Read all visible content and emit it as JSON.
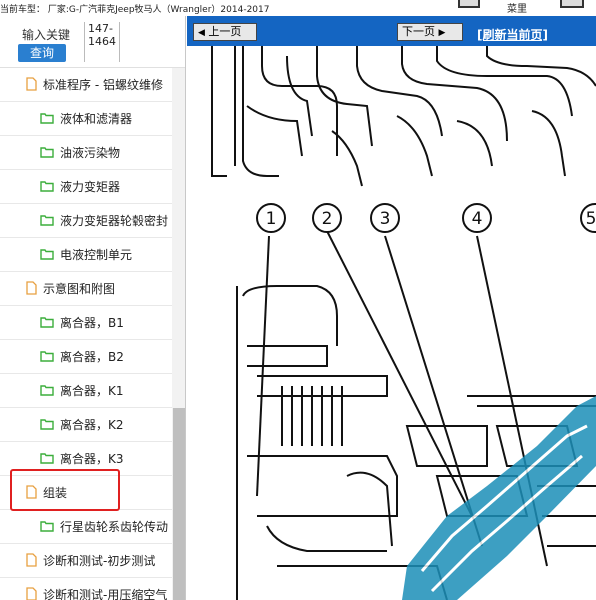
{
  "topbar": {
    "car_info": "当前车型： 厂家:G-广汽菲克Jeep牧马人（Wrangler）2014-2017",
    "menu_label": "菜里"
  },
  "search": {
    "label": "输入关键",
    "value": "147-\n1464",
    "button": "查询"
  },
  "tree": [
    {
      "label": "标准程序 - 铝螺纹维修",
      "icon": "file-icon",
      "level": 1
    },
    {
      "label": "液体和滤清器",
      "icon": "folder-icon",
      "level": 2
    },
    {
      "label": "油液污染物",
      "icon": "folder-icon",
      "level": 2
    },
    {
      "label": "液力变矩器",
      "icon": "folder-icon",
      "level": 2
    },
    {
      "label": "液力变矩器轮毂密封",
      "icon": "folder-icon",
      "level": 2
    },
    {
      "label": "电液控制单元",
      "icon": "folder-icon",
      "level": 2
    },
    {
      "label": "示意图和附图",
      "icon": "file-icon",
      "level": 1
    },
    {
      "label": "离合器，B1",
      "icon": "folder-icon",
      "level": 2
    },
    {
      "label": "离合器，B2",
      "icon": "folder-icon",
      "level": 2
    },
    {
      "label": "离合器，K1",
      "icon": "folder-icon",
      "level": 2
    },
    {
      "label": "离合器，K2",
      "icon": "folder-icon",
      "level": 2
    },
    {
      "label": "离合器，K3",
      "icon": "folder-icon",
      "level": 2
    },
    {
      "label": "组装",
      "icon": "file-icon",
      "level": 1
    },
    {
      "label": "行星齿轮系齿轮传动",
      "icon": "folder-icon",
      "level": 2
    },
    {
      "label": "诊断和测试-初步测试",
      "icon": "file-icon",
      "level": 1
    },
    {
      "label": "诊断和测试-用压缩空气",
      "icon": "file-icon",
      "level": 1
    }
  ],
  "nav": {
    "prev": "上一页",
    "next": "下一页",
    "refresh": "[刷新当前页]"
  },
  "diagram": {
    "callouts": [
      "1",
      "2",
      "3",
      "4",
      "5"
    ]
  },
  "colors": {
    "nav_blue": "#1465c2",
    "query_blue": "#2a7fd0",
    "folder_green": "#3cae3c",
    "file_orange": "#e8a040",
    "highlight_red": "#e02020"
  }
}
